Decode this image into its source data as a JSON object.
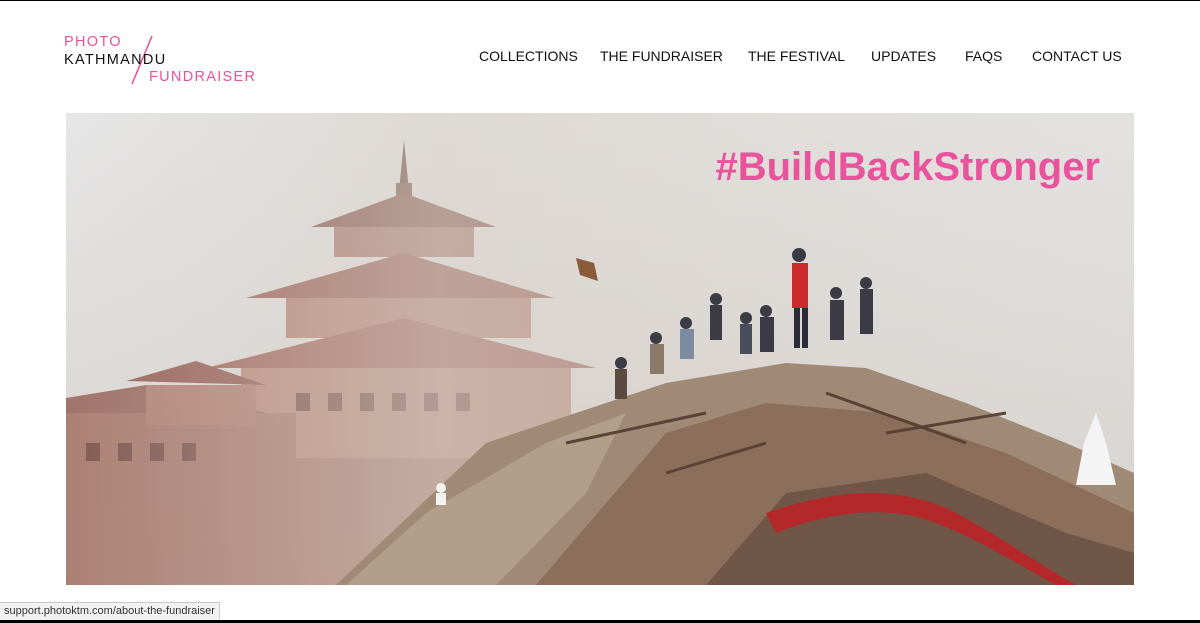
{
  "logo": {
    "line1": "PHOTO",
    "line2": "KATHMANDU",
    "line3": "FUNDRAISER",
    "accent_color": "#e8539c"
  },
  "nav": {
    "items": [
      "COLLECTIONS",
      "THE FUNDRAISER",
      "THE FESTIVAL",
      "UPDATES",
      "FAQS",
      "CONTACT US"
    ]
  },
  "hero": {
    "hashtag": "#BuildBackStronger",
    "image": "earthquake-rubble-temple-photo"
  },
  "status_bar": {
    "url": "support.photoktm.com/about-the-fundraiser"
  }
}
